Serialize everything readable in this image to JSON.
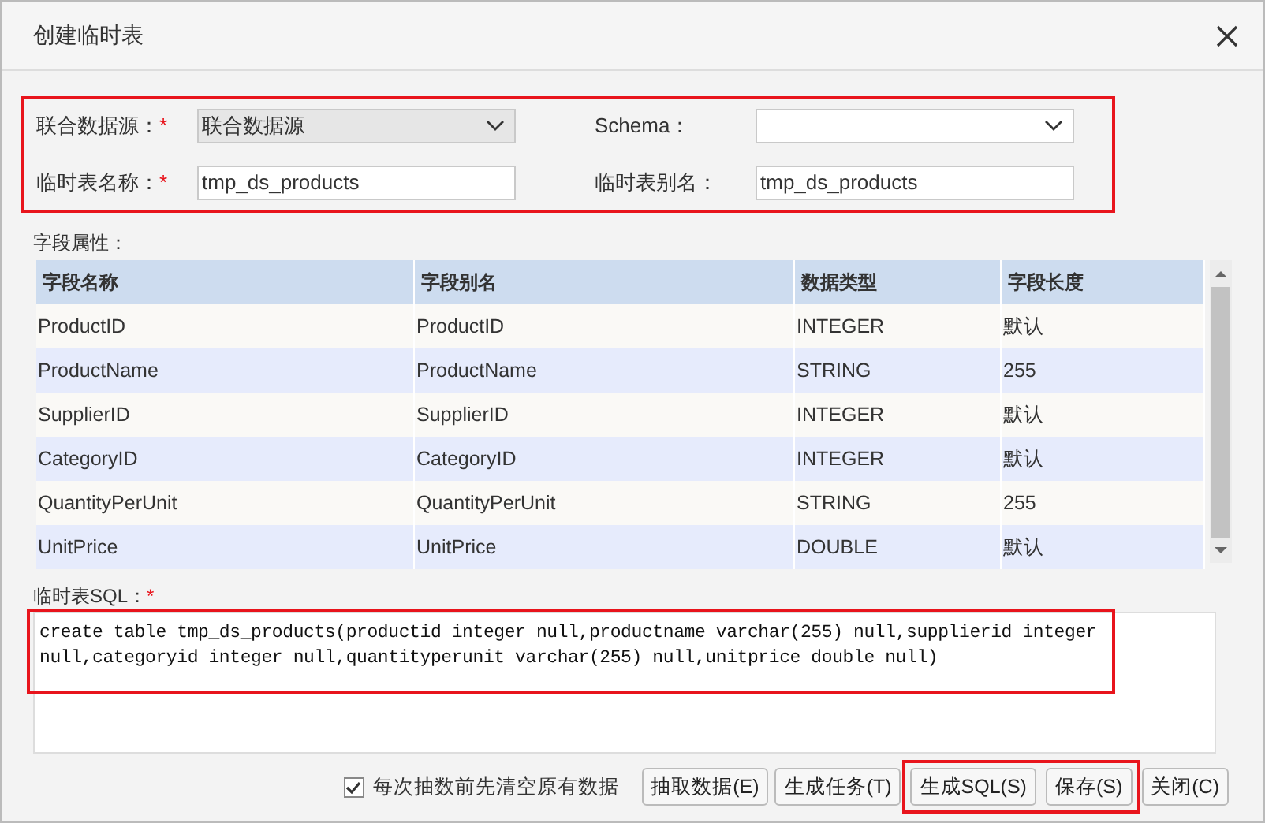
{
  "dialog": {
    "title": "创建临时表"
  },
  "form": {
    "highlighted": true,
    "fields": [
      {
        "label": "联合数据源：",
        "required_mark": "*",
        "kind": "select",
        "value": "联合数据源",
        "disabled": true
      },
      {
        "label": "Schema：",
        "kind": "select",
        "disabled": false
      },
      {
        "label": "临时表名称：",
        "required_mark": "*",
        "kind": "text",
        "value": "tmp_ds_products",
        "disabled": false
      },
      {
        "label": "临时表别名：",
        "kind": "text",
        "value": "tmp_ds_products",
        "disabled": false
      }
    ]
  },
  "fields_section": {
    "label": "字段属性：",
    "table": {
      "columns": [
        "字段名称",
        "字段别名",
        "数据类型",
        "字段长度"
      ],
      "rows": [
        [
          "ProductID",
          "ProductID",
          "INTEGER",
          "默认"
        ],
        [
          "ProductName",
          "ProductName",
          "STRING",
          "255"
        ],
        [
          "SupplierID",
          "SupplierID",
          "INTEGER",
          "默认"
        ],
        [
          "CategoryID",
          "CategoryID",
          "INTEGER",
          "默认"
        ],
        [
          "QuantityPerUnit",
          "QuantityPerUnit",
          "STRING",
          "255"
        ],
        [
          "UnitPrice",
          "UnitPrice",
          "DOUBLE",
          "默认"
        ]
      ]
    }
  },
  "sql": {
    "label": "临时表SQL：",
    "required_mark": "*",
    "highlighted": true,
    "value": "create table tmp_ds_products(productid integer null,productname varchar(255) null,supplierid integer null,categoryid integer null,quantityperunit varchar(255) null,unitprice double null)"
  },
  "clear_option": {
    "label": "每次抽数前先清空原有数据",
    "checked": true
  },
  "buttons": [
    {
      "label": "抽取数据(E)",
      "highlighted": false
    },
    {
      "label": "生成任务(T)",
      "highlighted": false
    },
    {
      "label": "生成SQL(S)",
      "highlighted": true
    },
    {
      "label": "保存(S)",
      "highlighted": true
    },
    {
      "label": "关闭(C)",
      "highlighted": false
    }
  ]
}
